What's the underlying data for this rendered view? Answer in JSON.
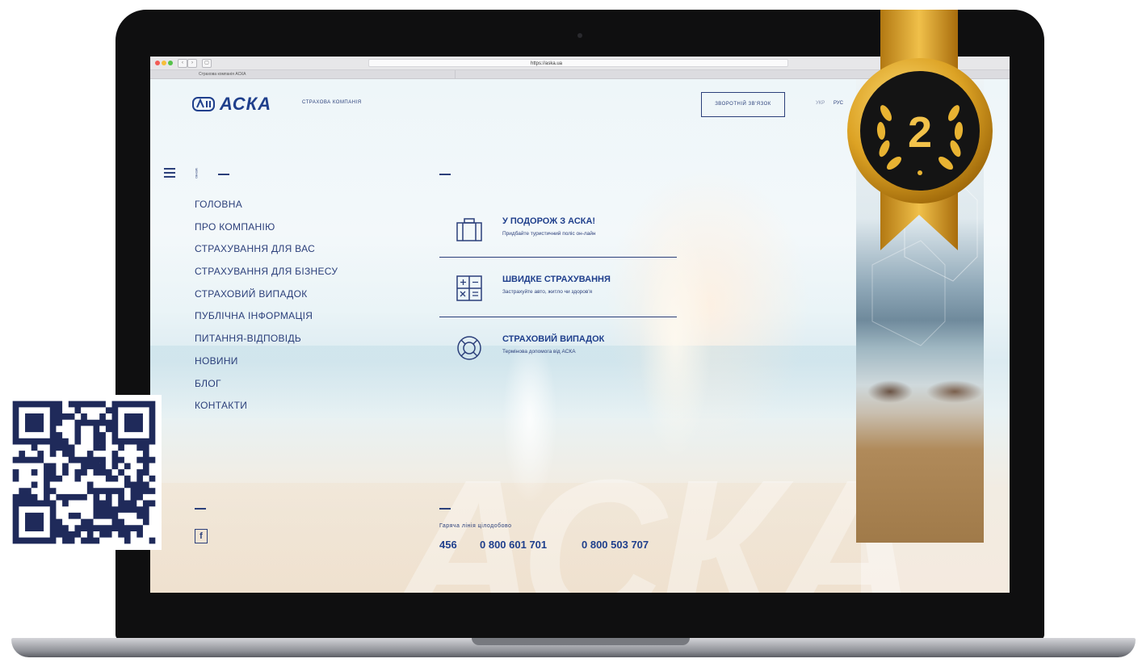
{
  "browser": {
    "url": "https://aska.ua",
    "tab_title": "Страхова компанія АСКА",
    "back_glyph": "‹",
    "forward_glyph": "›",
    "sidebar_glyph": "▢"
  },
  "header": {
    "logo_text": "АСКА",
    "tagline": "СТРАХОВА КОМПАНІЯ",
    "callback_label": "ЗВОРОТНІЙ ЗВ'ЯЗОК",
    "lang_ukr": "УКР",
    "lang_rus": "РУС"
  },
  "menu": {
    "vertical_label": "МЕНЮ",
    "items": [
      "ГОЛОВНА",
      "ПРО КОМПАНІЮ",
      "СТРАХУВАННЯ ДЛЯ ВАС",
      "СТРАХУВАННЯ ДЛЯ БІЗНЕСУ",
      "СТРАХОВИЙ ВИПАДОК",
      "ПУБЛІЧНА ІНФОРМАЦІЯ",
      "ПИТАННЯ-ВІДПОВІДЬ",
      "НОВИНИ",
      "БЛОГ",
      "КОНТАКТИ"
    ]
  },
  "services": [
    {
      "title": "У ПОДОРОЖ З АСКА!",
      "subtitle": "Придбайте туристичний поліс он-лайн",
      "icon": "suitcase-icon"
    },
    {
      "title": "ШВИДКЕ СТРАХУВАННЯ",
      "subtitle": "Застрахуйте авто, житло чи здоров'я",
      "icon": "calculator-icon"
    },
    {
      "title": "СТРАХОВИЙ ВИПАДОК",
      "subtitle": "Термінова допомога від АСКА",
      "icon": "lifebuoy-icon"
    }
  ],
  "social": {
    "facebook_glyph": "f"
  },
  "hotline": {
    "label": "Гаряча лінія цілодобово",
    "phones": [
      "456",
      "0 800 601 701",
      "0 800 503 707"
    ]
  },
  "watermark_text": "АСКА",
  "badge": {
    "rank": "2",
    "icon": "laurel-medal-icon"
  },
  "qr": {
    "icon": "qr-code-icon"
  },
  "colors": {
    "brand_blue": "#1f3f8c",
    "text_blue": "#2b3f7a",
    "gold": "#d9a21b"
  }
}
